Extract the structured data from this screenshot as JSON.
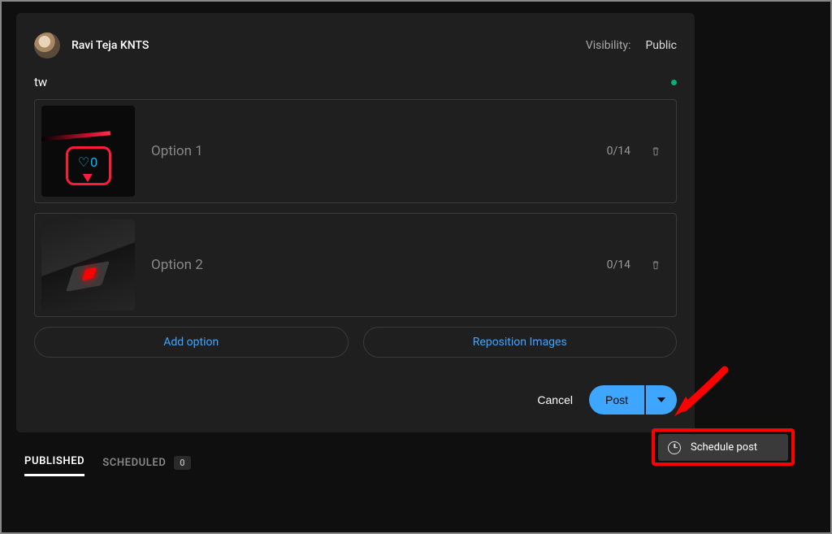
{
  "header": {
    "username": "Ravi Teja KNTS",
    "visibility_label": "Visibility:",
    "visibility_value": "Public"
  },
  "post": {
    "title": "tw",
    "options": [
      {
        "placeholder": "Option 1",
        "count": "0/14"
      },
      {
        "placeholder": "Option 2",
        "count": "0/14"
      }
    ]
  },
  "actions": {
    "add_option": "Add option",
    "reposition": "Reposition Images",
    "cancel": "Cancel",
    "post": "Post"
  },
  "dropdown": {
    "schedule": "Schedule post"
  },
  "tabs": {
    "published": "PUBLISHED",
    "scheduled": "SCHEDULED",
    "scheduled_count": "0"
  }
}
